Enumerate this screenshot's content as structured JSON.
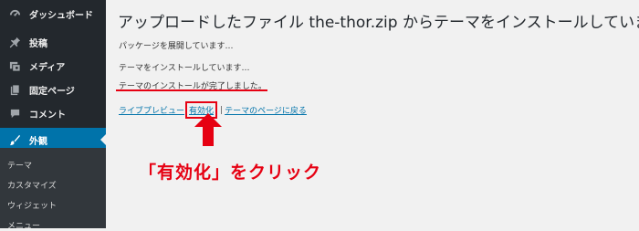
{
  "sidebar": {
    "items": [
      {
        "label": "ダッシュボード",
        "icon": "dashboard-icon"
      },
      {
        "label": "投稿",
        "icon": "pushpin-icon"
      },
      {
        "label": "メディア",
        "icon": "media-icon"
      },
      {
        "label": "固定ページ",
        "icon": "page-icon"
      },
      {
        "label": "コメント",
        "icon": "comment-icon"
      },
      {
        "label": "外観",
        "icon": "brush-icon",
        "active": true
      }
    ],
    "submenu": [
      "テーマ",
      "カスタマイズ",
      "ウィジェット",
      "メニュー"
    ]
  },
  "main": {
    "title": "アップロードしたファイル the-thor.zip からテーマをインストールしています",
    "status_lines": [
      "パッケージを展開しています…",
      "テーマをインストールしています…",
      "テーマのインストールが完了しました。"
    ],
    "links": {
      "live_preview": "ライブプレビュー",
      "activate": "有効化",
      "theme_page": "テーマのページに戻る",
      "separator": "|"
    }
  },
  "annotation": {
    "callout": "「有効化」をクリック"
  },
  "colors": {
    "sidebar_bg": "#23282d",
    "active_bg": "#0073aa",
    "link": "#0073aa",
    "annotation_red": "#e60012"
  }
}
